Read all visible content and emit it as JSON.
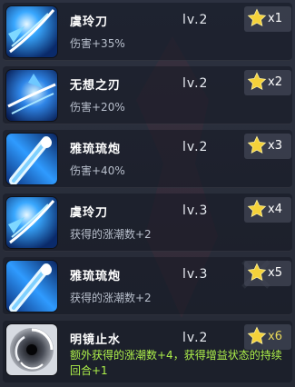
{
  "skills": [
    {
      "name": "虞玲刀",
      "level": "lv.2",
      "effect": "伤害+35%",
      "stack": "x1",
      "icon": "blue-slash-icon"
    },
    {
      "name": "无想之刃",
      "level": "lv.2",
      "effect": "伤害+20%",
      "stack": "x2",
      "icon": "blue-slash-icon"
    },
    {
      "name": "雅琉琉炮",
      "level": "lv.2",
      "effect": "伤害+40%",
      "stack": "x3",
      "icon": "cannon-beam-icon"
    },
    {
      "name": "虞玲刀",
      "level": "lv.3",
      "effect": "获得的涨潮数+2",
      "stack": "x4",
      "icon": "blue-slash-icon"
    },
    {
      "name": "雅琉琉炮",
      "level": "lv.3",
      "effect": "获得的涨潮数+2",
      "stack": "x5",
      "icon": "cannon-beam-icon"
    },
    {
      "name": "明镜止水",
      "level": "lv.2",
      "effect": "额外获得的涨潮数+4，获得增益状态的持续回合+1",
      "stack": "x6",
      "icon": "mirror-vortex-icon"
    }
  ],
  "colors": {
    "star": "#f5d23a",
    "gold_count": "#e8d85a",
    "green_text": "#aef04a"
  }
}
